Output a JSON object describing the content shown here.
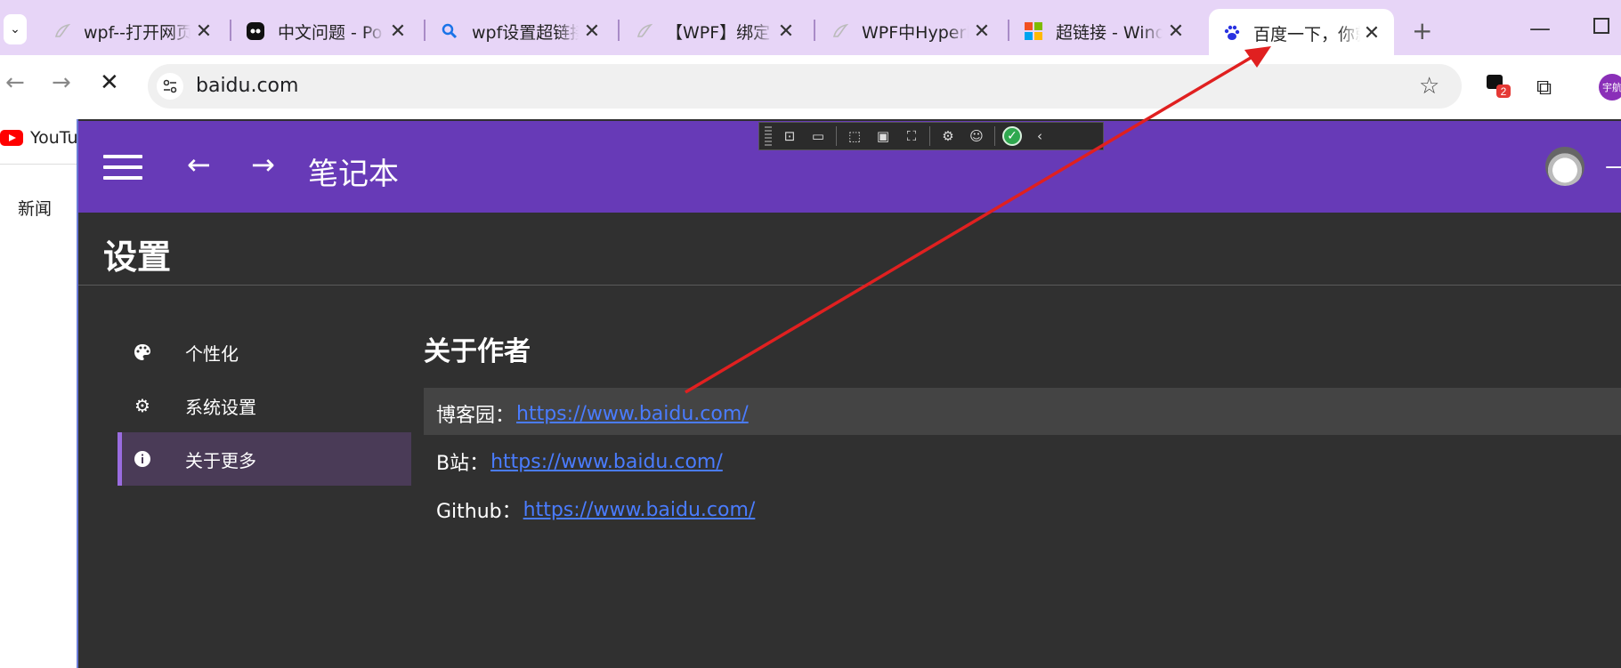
{
  "browser": {
    "tabs": [
      {
        "title": "wpf--打开网页",
        "favicon": "feather-icon"
      },
      {
        "title": "中文问题 - Po",
        "favicon": "poe-icon"
      },
      {
        "title": "wpf设置超链接",
        "favicon": "search-icon"
      },
      {
        "title": "【WPF】绑定",
        "favicon": "feather-icon"
      },
      {
        "title": "WPF中Hyperl",
        "favicon": "feather-icon"
      },
      {
        "title": "超链接 - Wind",
        "favicon": "microsoft-icon"
      },
      {
        "title": "百度一下，你就",
        "favicon": "baidu-icon",
        "active": true
      }
    ],
    "new_tab": "+",
    "url": "baidu.com",
    "extension_badge": "2",
    "profile_label": "宇航"
  },
  "bookmarks": {
    "youtube": "YouTube"
  },
  "background_page": {
    "news": "新闻"
  },
  "app": {
    "title": "笔记本",
    "page_title": "设置",
    "nav": [
      {
        "label": "个性化",
        "icon": "palette-icon"
      },
      {
        "label": "系统设置",
        "icon": "gear-icon"
      },
      {
        "label": "关于更多",
        "icon": "info-icon",
        "selected": true
      }
    ],
    "about": {
      "heading": "关于作者",
      "links": [
        {
          "label": "博客园：",
          "url": "https://www.baidu.com/"
        },
        {
          "label": "B站：",
          "url": "https://www.baidu.com/"
        },
        {
          "label": "Github：",
          "url": "https://www.baidu.com/"
        }
      ]
    }
  },
  "colors": {
    "app_bar": "#673ab7",
    "app_bg": "#303030",
    "link": "#4a7cff",
    "annotation_arrow": "#e02020",
    "tab_strip": "#e7d5f7"
  }
}
